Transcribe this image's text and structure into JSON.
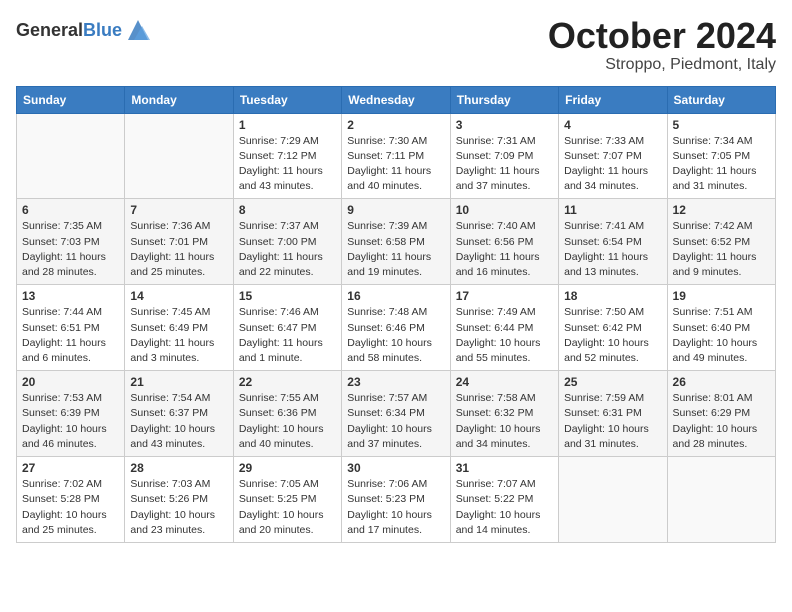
{
  "header": {
    "logo_general": "General",
    "logo_blue": "Blue",
    "title": "October 2024",
    "location": "Stroppo, Piedmont, Italy"
  },
  "calendar": {
    "days_of_week": [
      "Sunday",
      "Monday",
      "Tuesday",
      "Wednesday",
      "Thursday",
      "Friday",
      "Saturday"
    ],
    "weeks": [
      [
        {
          "day": "",
          "info": ""
        },
        {
          "day": "",
          "info": ""
        },
        {
          "day": "1",
          "info": "Sunrise: 7:29 AM\nSunset: 7:12 PM\nDaylight: 11 hours and 43 minutes."
        },
        {
          "day": "2",
          "info": "Sunrise: 7:30 AM\nSunset: 7:11 PM\nDaylight: 11 hours and 40 minutes."
        },
        {
          "day": "3",
          "info": "Sunrise: 7:31 AM\nSunset: 7:09 PM\nDaylight: 11 hours and 37 minutes."
        },
        {
          "day": "4",
          "info": "Sunrise: 7:33 AM\nSunset: 7:07 PM\nDaylight: 11 hours and 34 minutes."
        },
        {
          "day": "5",
          "info": "Sunrise: 7:34 AM\nSunset: 7:05 PM\nDaylight: 11 hours and 31 minutes."
        }
      ],
      [
        {
          "day": "6",
          "info": "Sunrise: 7:35 AM\nSunset: 7:03 PM\nDaylight: 11 hours and 28 minutes."
        },
        {
          "day": "7",
          "info": "Sunrise: 7:36 AM\nSunset: 7:01 PM\nDaylight: 11 hours and 25 minutes."
        },
        {
          "day": "8",
          "info": "Sunrise: 7:37 AM\nSunset: 7:00 PM\nDaylight: 11 hours and 22 minutes."
        },
        {
          "day": "9",
          "info": "Sunrise: 7:39 AM\nSunset: 6:58 PM\nDaylight: 11 hours and 19 minutes."
        },
        {
          "day": "10",
          "info": "Sunrise: 7:40 AM\nSunset: 6:56 PM\nDaylight: 11 hours and 16 minutes."
        },
        {
          "day": "11",
          "info": "Sunrise: 7:41 AM\nSunset: 6:54 PM\nDaylight: 11 hours and 13 minutes."
        },
        {
          "day": "12",
          "info": "Sunrise: 7:42 AM\nSunset: 6:52 PM\nDaylight: 11 hours and 9 minutes."
        }
      ],
      [
        {
          "day": "13",
          "info": "Sunrise: 7:44 AM\nSunset: 6:51 PM\nDaylight: 11 hours and 6 minutes."
        },
        {
          "day": "14",
          "info": "Sunrise: 7:45 AM\nSunset: 6:49 PM\nDaylight: 11 hours and 3 minutes."
        },
        {
          "day": "15",
          "info": "Sunrise: 7:46 AM\nSunset: 6:47 PM\nDaylight: 11 hours and 1 minute."
        },
        {
          "day": "16",
          "info": "Sunrise: 7:48 AM\nSunset: 6:46 PM\nDaylight: 10 hours and 58 minutes."
        },
        {
          "day": "17",
          "info": "Sunrise: 7:49 AM\nSunset: 6:44 PM\nDaylight: 10 hours and 55 minutes."
        },
        {
          "day": "18",
          "info": "Sunrise: 7:50 AM\nSunset: 6:42 PM\nDaylight: 10 hours and 52 minutes."
        },
        {
          "day": "19",
          "info": "Sunrise: 7:51 AM\nSunset: 6:40 PM\nDaylight: 10 hours and 49 minutes."
        }
      ],
      [
        {
          "day": "20",
          "info": "Sunrise: 7:53 AM\nSunset: 6:39 PM\nDaylight: 10 hours and 46 minutes."
        },
        {
          "day": "21",
          "info": "Sunrise: 7:54 AM\nSunset: 6:37 PM\nDaylight: 10 hours and 43 minutes."
        },
        {
          "day": "22",
          "info": "Sunrise: 7:55 AM\nSunset: 6:36 PM\nDaylight: 10 hours and 40 minutes."
        },
        {
          "day": "23",
          "info": "Sunrise: 7:57 AM\nSunset: 6:34 PM\nDaylight: 10 hours and 37 minutes."
        },
        {
          "day": "24",
          "info": "Sunrise: 7:58 AM\nSunset: 6:32 PM\nDaylight: 10 hours and 34 minutes."
        },
        {
          "day": "25",
          "info": "Sunrise: 7:59 AM\nSunset: 6:31 PM\nDaylight: 10 hours and 31 minutes."
        },
        {
          "day": "26",
          "info": "Sunrise: 8:01 AM\nSunset: 6:29 PM\nDaylight: 10 hours and 28 minutes."
        }
      ],
      [
        {
          "day": "27",
          "info": "Sunrise: 7:02 AM\nSunset: 5:28 PM\nDaylight: 10 hours and 25 minutes."
        },
        {
          "day": "28",
          "info": "Sunrise: 7:03 AM\nSunset: 5:26 PM\nDaylight: 10 hours and 23 minutes."
        },
        {
          "day": "29",
          "info": "Sunrise: 7:05 AM\nSunset: 5:25 PM\nDaylight: 10 hours and 20 minutes."
        },
        {
          "day": "30",
          "info": "Sunrise: 7:06 AM\nSunset: 5:23 PM\nDaylight: 10 hours and 17 minutes."
        },
        {
          "day": "31",
          "info": "Sunrise: 7:07 AM\nSunset: 5:22 PM\nDaylight: 10 hours and 14 minutes."
        },
        {
          "day": "",
          "info": ""
        },
        {
          "day": "",
          "info": ""
        }
      ]
    ]
  }
}
